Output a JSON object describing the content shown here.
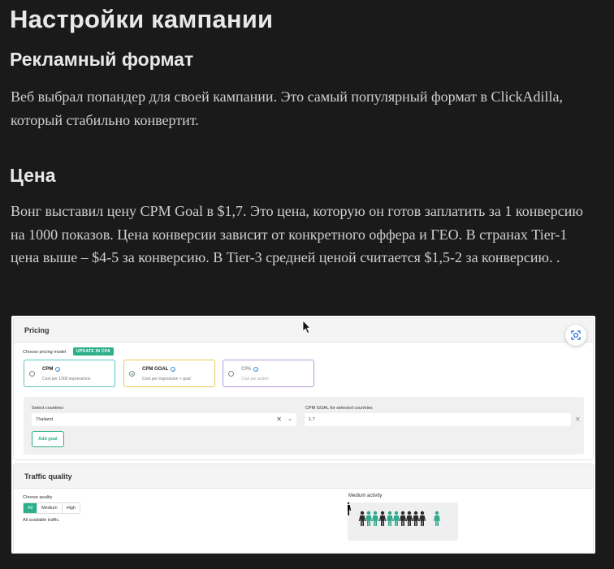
{
  "page": {
    "title": "Настройки кампании",
    "section1": {
      "heading": "Рекламный формат",
      "text": "Веб выбрал попандер для своей кампании. Это самый популярный формат в ClickAdilla, который стабильно конвертит."
    },
    "section2": {
      "heading": "Цена",
      "text": "Вонг выставил цену CPM Goal в $1,7. Это цена, которую он готов заплатить за 1 конверсию на 1000 показов. Цена конверсии зависит от конкретного оффера и ГЕО. В странах Tier-1 цена выше – $4-5 за конверсию. В Tier-3 средней ценой считается $1,5-2 за конверсию. ."
    }
  },
  "screenshot": {
    "pricing": {
      "title": "Pricing",
      "choose_label": "Choose pricing model",
      "update_badge": "UPDATE IN CPA",
      "models": [
        {
          "name": "CPM",
          "sub": "Cost per 1000 impressions",
          "selected": false
        },
        {
          "name": "CPM GOAL",
          "sub": "Cost per impression + goal",
          "selected": true
        },
        {
          "name": "CPA",
          "sub": "Cost per action",
          "selected": false
        }
      ],
      "countries_label": "Select countries",
      "country_value": "Thailand",
      "goal_label": "CPM GOAL for selected countries",
      "goal_value": "1.7",
      "add_goal": "Add goal"
    },
    "traffic": {
      "title": "Traffic quality",
      "choose_label": "Choose quality",
      "options": [
        "All",
        "Medium",
        "High"
      ],
      "selected": "All",
      "note": "All available traffic.",
      "activity_label": "Medium activity"
    }
  }
}
